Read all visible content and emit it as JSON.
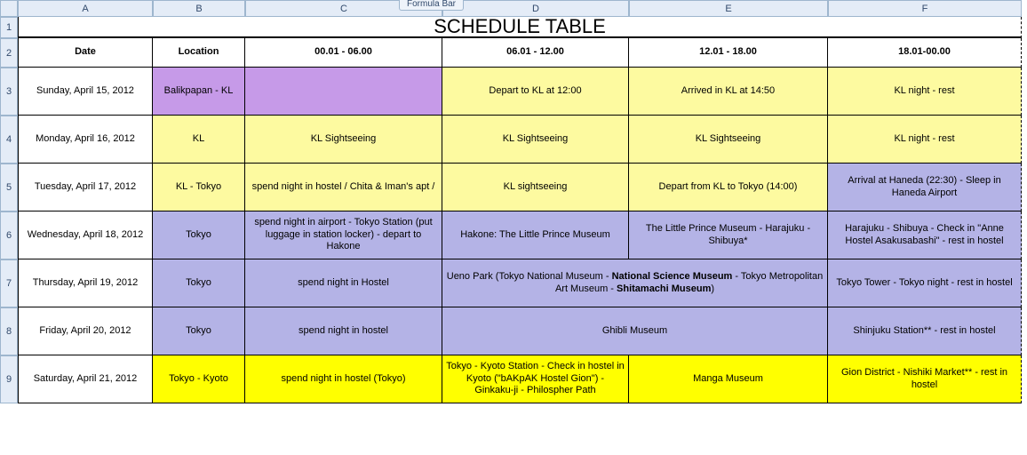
{
  "formula_bar_label": "Formula Bar",
  "col_headers": [
    "A",
    "B",
    "C",
    "D",
    "E",
    "F"
  ],
  "row_headers": [
    "1",
    "2",
    "3",
    "4",
    "5",
    "6",
    "7",
    "8",
    "9"
  ],
  "title": "SCHEDULE TABLE",
  "table_headers": {
    "date": "Date",
    "location": "Location",
    "t1": "00.01 - 06.00",
    "t2": "06.01 - 12.00",
    "t3": "12.01 - 18.00",
    "t4": "18.01-00.00"
  },
  "rows": [
    {
      "date": "Sunday, April 15, 2012",
      "location": "Balikpapan - KL",
      "c1": "",
      "c2": "Depart to KL at 12:00",
      "c3": "Arrived in KL at 14:50",
      "c4": "KL night - rest",
      "fill": {
        "location": "purple",
        "c1": "purple",
        "c2": "lyellow",
        "c3": "lyellow",
        "c4": "lyellow"
      }
    },
    {
      "date": "Monday, April 16, 2012",
      "location": "KL",
      "c1": "KL Sightseeing",
      "c2": "KL Sightseeing",
      "c3": "KL Sightseeing",
      "c4": "KL night - rest",
      "fill": {
        "location": "lyellow",
        "c1": "lyellow",
        "c2": "lyellow",
        "c3": "lyellow",
        "c4": "lyellow"
      }
    },
    {
      "date": "Tuesday, April 17, 2012",
      "location": "KL - Tokyo",
      "c1": "spend night in hostel / Chita & Iman's apt /",
      "c2": "KL sightseeing",
      "c3": "Depart from KL to Tokyo (14:00)",
      "c4": "Arrival at Haneda (22:30) - Sleep in Haneda Airport",
      "fill": {
        "location": "lyellow",
        "c1": "lyellow",
        "c2": "lyellow",
        "c3": "lyellow",
        "c4": "lilac"
      }
    },
    {
      "date": "Wednesday, April 18, 2012",
      "location": "Tokyo",
      "c1": "spend night in airport - Tokyo Station (put luggage in station locker) - depart to Hakone",
      "c2": "Hakone: The Little Prince Museum",
      "c3": "The Little Prince Museum - Harajuku - Shibuya*",
      "c4": "Harajuku - Shibuya - Check in \"Anne Hostel Asakusabashi\" - rest in hostel",
      "fill": {
        "location": "lilac",
        "c1": "lilac",
        "c2": "lilac",
        "c3": "lilac",
        "c4": "lilac"
      }
    },
    {
      "date": "Thursday, April 19, 2012",
      "location": "Tokyo",
      "c1": "spend night in Hostel",
      "merged23_pre": "Ueno Park (Tokyo National Museum - ",
      "merged23_b1": "National Science Museum",
      "merged23_mid": " - Tokyo Metropolitan Art Museum - ",
      "merged23_b2": "Shitamachi Museum",
      "merged23_suf": ")",
      "c4": "Tokyo Tower - Tokyo night - rest in hostel",
      "fill": {
        "location": "lilac",
        "c1": "lilac",
        "merged": "lilac",
        "c4": "lilac"
      }
    },
    {
      "date": "Friday, April 20, 2012",
      "location": "Tokyo",
      "c1": "spend night in hostel",
      "merged23": "Ghibli Museum",
      "c4": "Shinjuku Station** - rest in hostel",
      "fill": {
        "location": "lilac",
        "c1": "lilac",
        "merged": "lilac",
        "c4": "lilac"
      }
    },
    {
      "date": "Saturday, April 21, 2012",
      "location": "Tokyo - Kyoto",
      "c1": "spend night in hostel (Tokyo)",
      "c2": "Tokyo - Kyoto Station - Check in hostel in Kyoto (\"bAKpAK Hostel Gion\") - Ginkaku-ji - Philospher Path",
      "c3": "Manga Museum",
      "c4": "Gion District - Nishiki Market** - rest in hostel",
      "fill": {
        "location": "yellow",
        "c1": "yellow",
        "c2": "yellow",
        "c3": "yellow",
        "c4": "yellow"
      }
    }
  ]
}
